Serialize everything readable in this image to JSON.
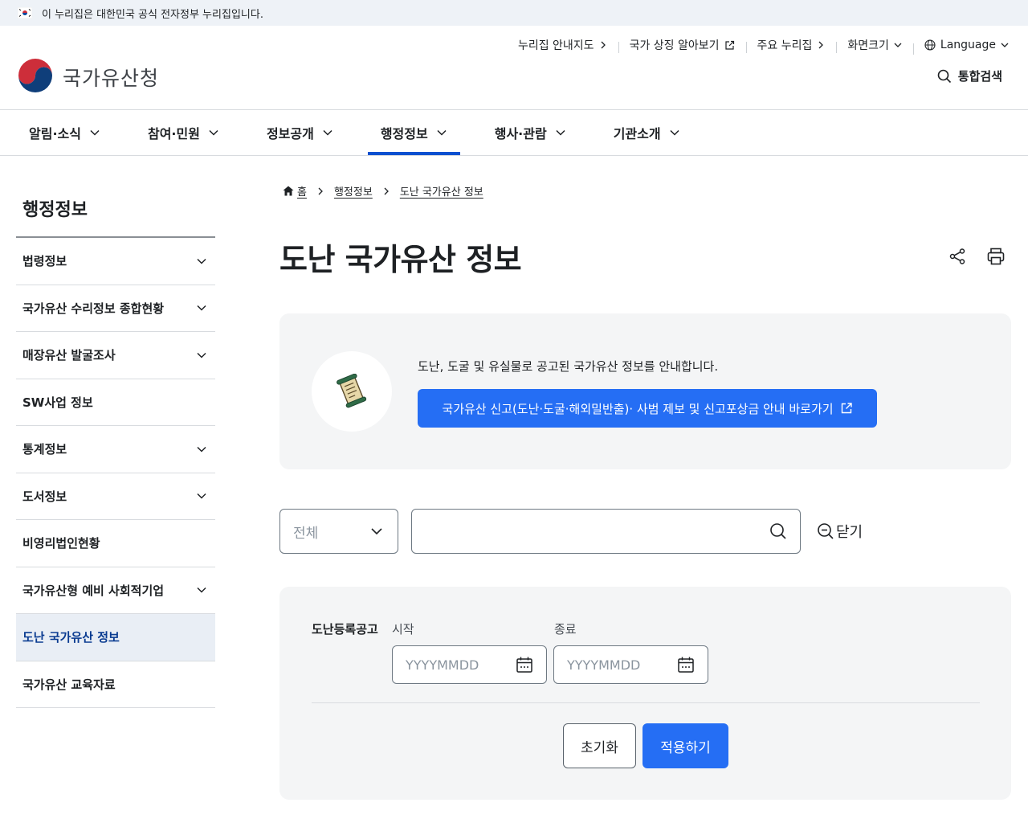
{
  "gov_banner": {
    "text": "이 누리집은 대한민국 공식 전자정부 누리집입니다."
  },
  "util_nav": [
    {
      "label": "누리집 안내지도",
      "icon": "chevron-right-icon"
    },
    {
      "label": "국가 상징 알아보기",
      "icon": "external-link-icon"
    },
    {
      "label": "주요 누리집",
      "icon": "chevron-right-icon"
    },
    {
      "label": "화면크기",
      "icon": "chevron-down-icon"
    },
    {
      "label": "Language",
      "icon": "chevron-down-icon"
    }
  ],
  "logo": {
    "text": "국가유산청"
  },
  "total_search": {
    "label": "통합검색"
  },
  "gnb": [
    {
      "label": "알림·소식"
    },
    {
      "label": "참여·민원"
    },
    {
      "label": "정보공개"
    },
    {
      "label": "행정정보",
      "active": true
    },
    {
      "label": "행사·관람"
    },
    {
      "label": "기관소개"
    }
  ],
  "side": {
    "title": "행정정보",
    "items": [
      {
        "label": "법령정보",
        "expandable": true
      },
      {
        "label": "국가유산 수리정보 종합현황",
        "expandable": true
      },
      {
        "label": "매장유산 발굴조사",
        "expandable": true
      },
      {
        "label": "SW사업 정보",
        "expandable": false
      },
      {
        "label": "통계정보",
        "expandable": true
      },
      {
        "label": "도서정보",
        "expandable": true
      },
      {
        "label": "비영리법인현황",
        "expandable": false
      },
      {
        "label": "국가유산형 예비 사회적기업",
        "expandable": true
      },
      {
        "label": "도난 국가유산 정보",
        "expandable": false,
        "active": true
      },
      {
        "label": "국가유산 교육자료",
        "expandable": false
      }
    ]
  },
  "breadcrumb": {
    "home": "홈",
    "level1": "행정정보",
    "level2": "도난 국가유산 정보"
  },
  "page": {
    "title": "도난 국가유산 정보"
  },
  "info": {
    "description": "도난, 도굴 및 유실물로 공고된 국가유산 정보를 안내합니다.",
    "link_label": "국가유산 신고(도난·도굴·해외밀반출)· 사범 제보 및 신고포상금 안내 바로가기"
  },
  "search": {
    "select_value": "전체",
    "query": "",
    "close_label": "닫기"
  },
  "filter": {
    "label": "도난등록공고",
    "start_label": "시작",
    "end_label": "종료",
    "start_placeholder": "YYYYMMDD",
    "end_placeholder": "YYYYMMDD",
    "reset_label": "초기화",
    "apply_label": "적용하기"
  },
  "colors": {
    "primary": "#256ef4",
    "active_underline": "#0b50d0",
    "panel_bg": "#f4f5f6",
    "side_active_bg": "#e9eef5"
  }
}
